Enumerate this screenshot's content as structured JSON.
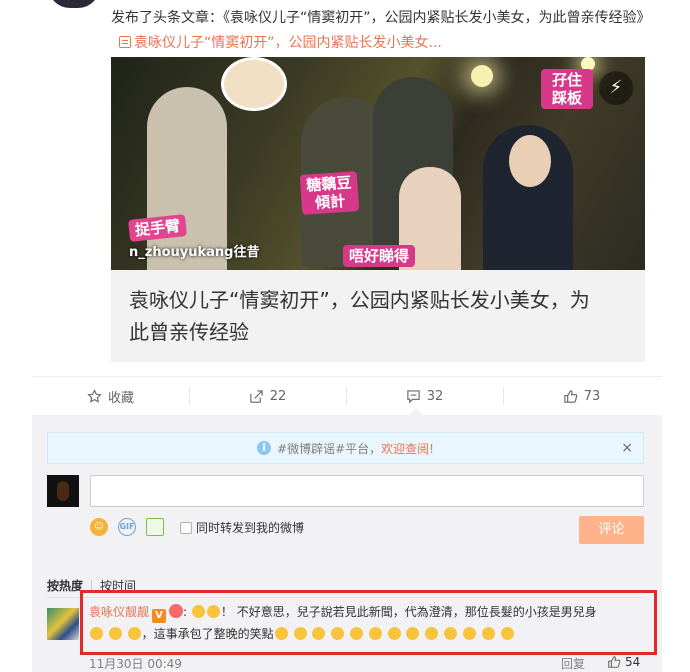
{
  "post": {
    "prefix": "发布了头条文章：《袁咏仪儿子“情窦初开”，公园内紧贴长发小美女，为此曾亲传经验》",
    "link_text": "袁咏仪儿子“情窦初开”，公园内紧贴长发小美女..."
  },
  "article": {
    "image_stickers": [
      "糖黐豆\n傾計",
      "孖住\n踩板",
      "捉手臂",
      "唔好睇得"
    ],
    "watermark": "n_zhouyukang往昔",
    "title": "袁咏仪儿子“情窦初开”，公园内紧贴长发小美女，为此曾亲传经验"
  },
  "actions": [
    {
      "label": "收藏",
      "icon": "star-icon"
    },
    {
      "label": "22",
      "icon": "share-icon"
    },
    {
      "label": "32",
      "icon": "comment-icon"
    },
    {
      "label": "73",
      "icon": "thumbs-up-icon"
    }
  ],
  "comments_panel": {
    "notice": {
      "prefix": "#微博辟谣#平台，",
      "link": "欢迎查阅!",
      "close": "×"
    },
    "input_placeholder": "",
    "repost_label": "同时转发到我的微博",
    "submit_label": "评论",
    "sort": {
      "hot": "按热度",
      "time": "按时间"
    }
  },
  "comment": {
    "user": "袁咏仪靓靓",
    "text_prefix": ":",
    "text": "！ 不好意思，兒子說若見此新聞，代為澄清，那位長髮的小孩是男兒身",
    "text_tail": "，這事承包了整晚的笑點",
    "time": "11月30日 00:49",
    "reply_label": "回复",
    "likes": "54"
  },
  "colors": {
    "accent": "#eb7350",
    "highlight_border": "#e02b2b",
    "panel_bg": "#f2f2f5"
  }
}
